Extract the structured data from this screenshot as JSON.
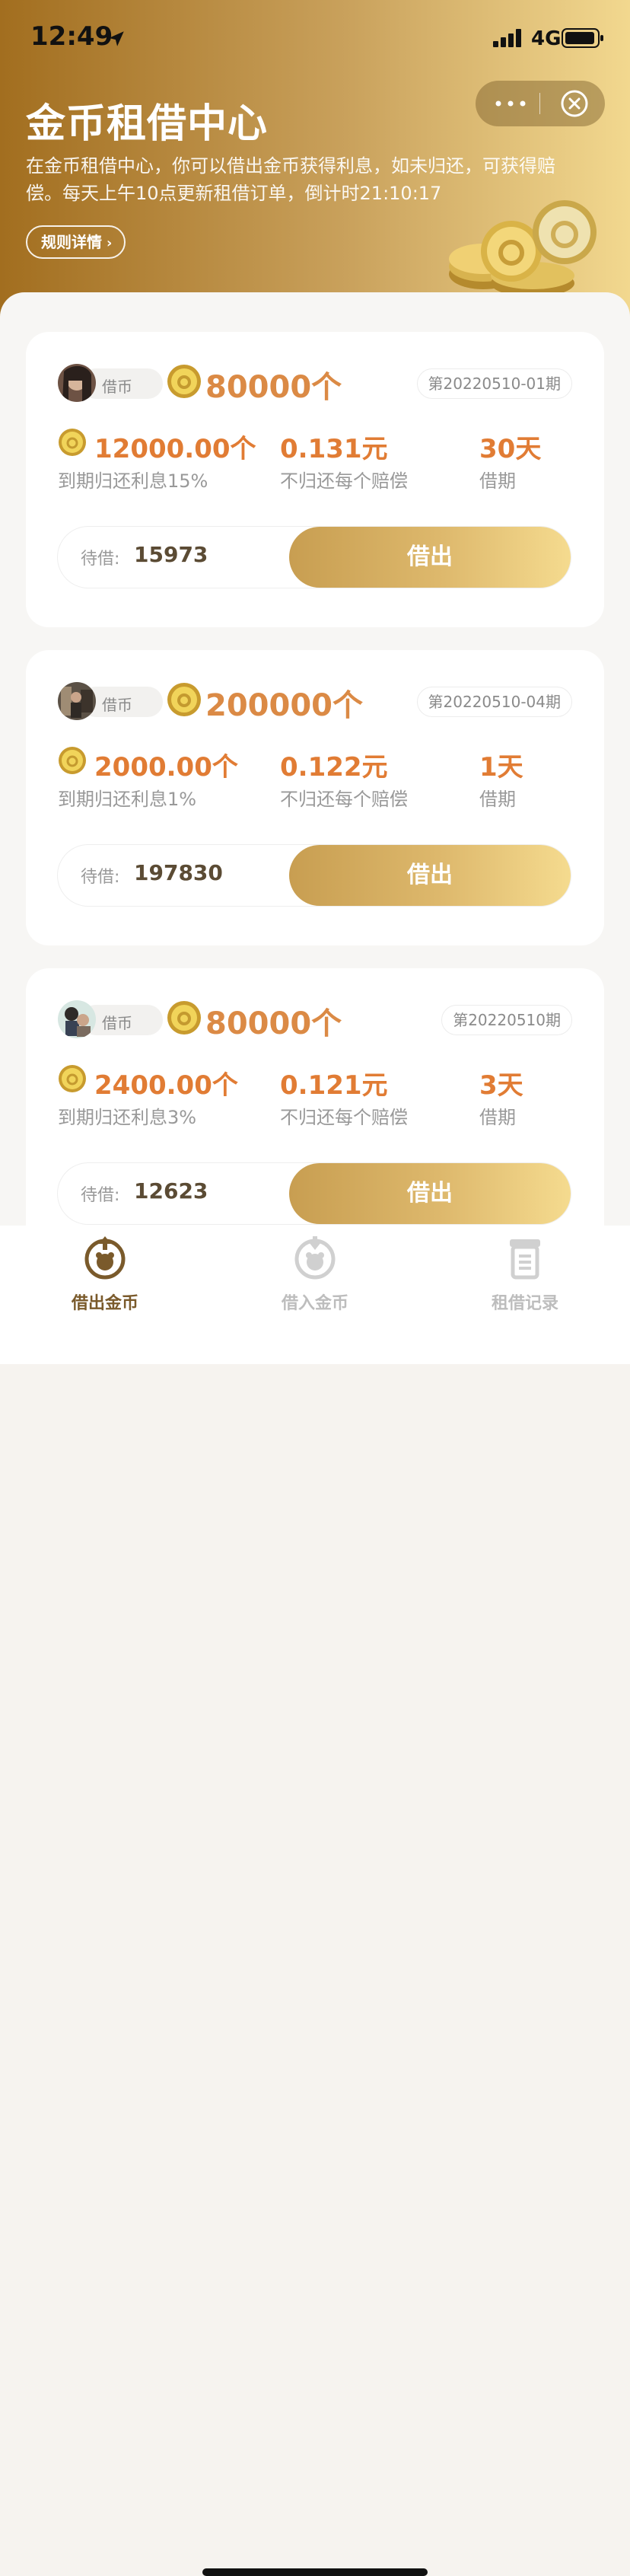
{
  "status_bar": {
    "time": "12:49",
    "network": "4G"
  },
  "header": {
    "title": "金币租借中心",
    "description": "在金币租借中心，你可以借出金币获得利息，如未归还，可获得赔偿。每天上午10点更新租借订单，倒计时21:10:17",
    "rules_button": "规则详情"
  },
  "cards": [
    {
      "tag": "借币",
      "amount": "80000个",
      "period": "第20220510-01期",
      "interest_value": "12000.00个",
      "interest_label": "到期归还利息15%",
      "compensation_value": "0.131元",
      "compensation_label": "不归还每个赔偿",
      "term_value": "30天",
      "term_label": "借期",
      "pending_label": "待借:",
      "pending_value": "15973",
      "action": "借出"
    },
    {
      "tag": "借币",
      "amount": "200000个",
      "period": "第20220510-04期",
      "interest_value": "2000.00个",
      "interest_label": "到期归还利息1%",
      "compensation_value": "0.122元",
      "compensation_label": "不归还每个赔偿",
      "term_value": "1天",
      "term_label": "借期",
      "pending_label": "待借:",
      "pending_value": "197830",
      "action": "借出"
    },
    {
      "tag": "借币",
      "amount": "80000个",
      "period": "第20220510期",
      "interest_value": "2400.00个",
      "interest_label": "到期归还利息3%",
      "compensation_value": "0.121元",
      "compensation_label": "不归还每个赔偿",
      "term_value": "3天",
      "term_label": "借期",
      "pending_label": "待借:",
      "pending_value": "12623",
      "action": "借出"
    }
  ],
  "tabbar": {
    "tabs": [
      {
        "label": "借出金币",
        "icon": "lend-coins-icon",
        "active": true
      },
      {
        "label": "借入金币",
        "icon": "borrow-coins-icon",
        "active": false
      },
      {
        "label": "租借记录",
        "icon": "records-icon",
        "active": false
      }
    ]
  },
  "colors": {
    "accent": "#e17c34",
    "gold_start": "#c89e51",
    "gold_end": "#f5db8f",
    "active_tab": "#7a5a2b",
    "inactive_tab": "#bdbdbd"
  }
}
